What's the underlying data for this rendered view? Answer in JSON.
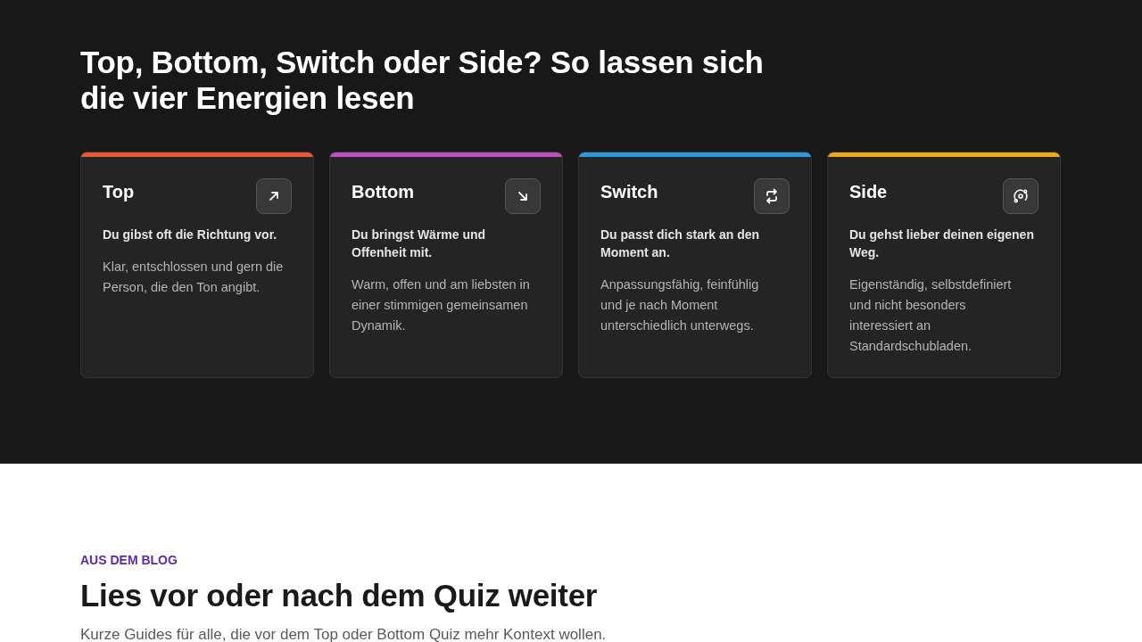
{
  "energies_section": {
    "title": "Top, Bottom, Switch oder Side? So lassen sich die vier Energien lesen",
    "cards": [
      {
        "kind": "top",
        "title": "Top",
        "color": "#e85a34",
        "lead": "Du gibst oft die Richtung vor.",
        "text": "Klar, entschlossen und gern die Person, die den Ton angibt."
      },
      {
        "kind": "bottom",
        "title": "Bottom",
        "color": "#c04fc4",
        "lead": "Du bringst Wärme und Offenheit mit.",
        "text": "Warm, offen und am liebsten in einer stimmigen gemeinsamen Dynamik."
      },
      {
        "kind": "switch",
        "title": "Switch",
        "color": "#2f99df",
        "lead": "Du passt dich stark an den Moment an.",
        "text": "Anpassungsfähig, feinfühlig und je nach Moment unterschiedlich unterwegs."
      },
      {
        "kind": "side",
        "title": "Side",
        "color": "#eda81e",
        "lead": "Du gehst lieber deinen eigenen Weg.",
        "text": "Eigenständig, selbstdefiniert und nicht besonders interessiert an Standardschubladen."
      }
    ]
  },
  "blog_section": {
    "eyebrow": "AUS DEM BLOG",
    "title": "Lies vor oder nach dem Quiz weiter",
    "intro": "Kurze Guides für alle, die vor dem Top oder Bottom Quiz mehr Kontext wollen."
  }
}
